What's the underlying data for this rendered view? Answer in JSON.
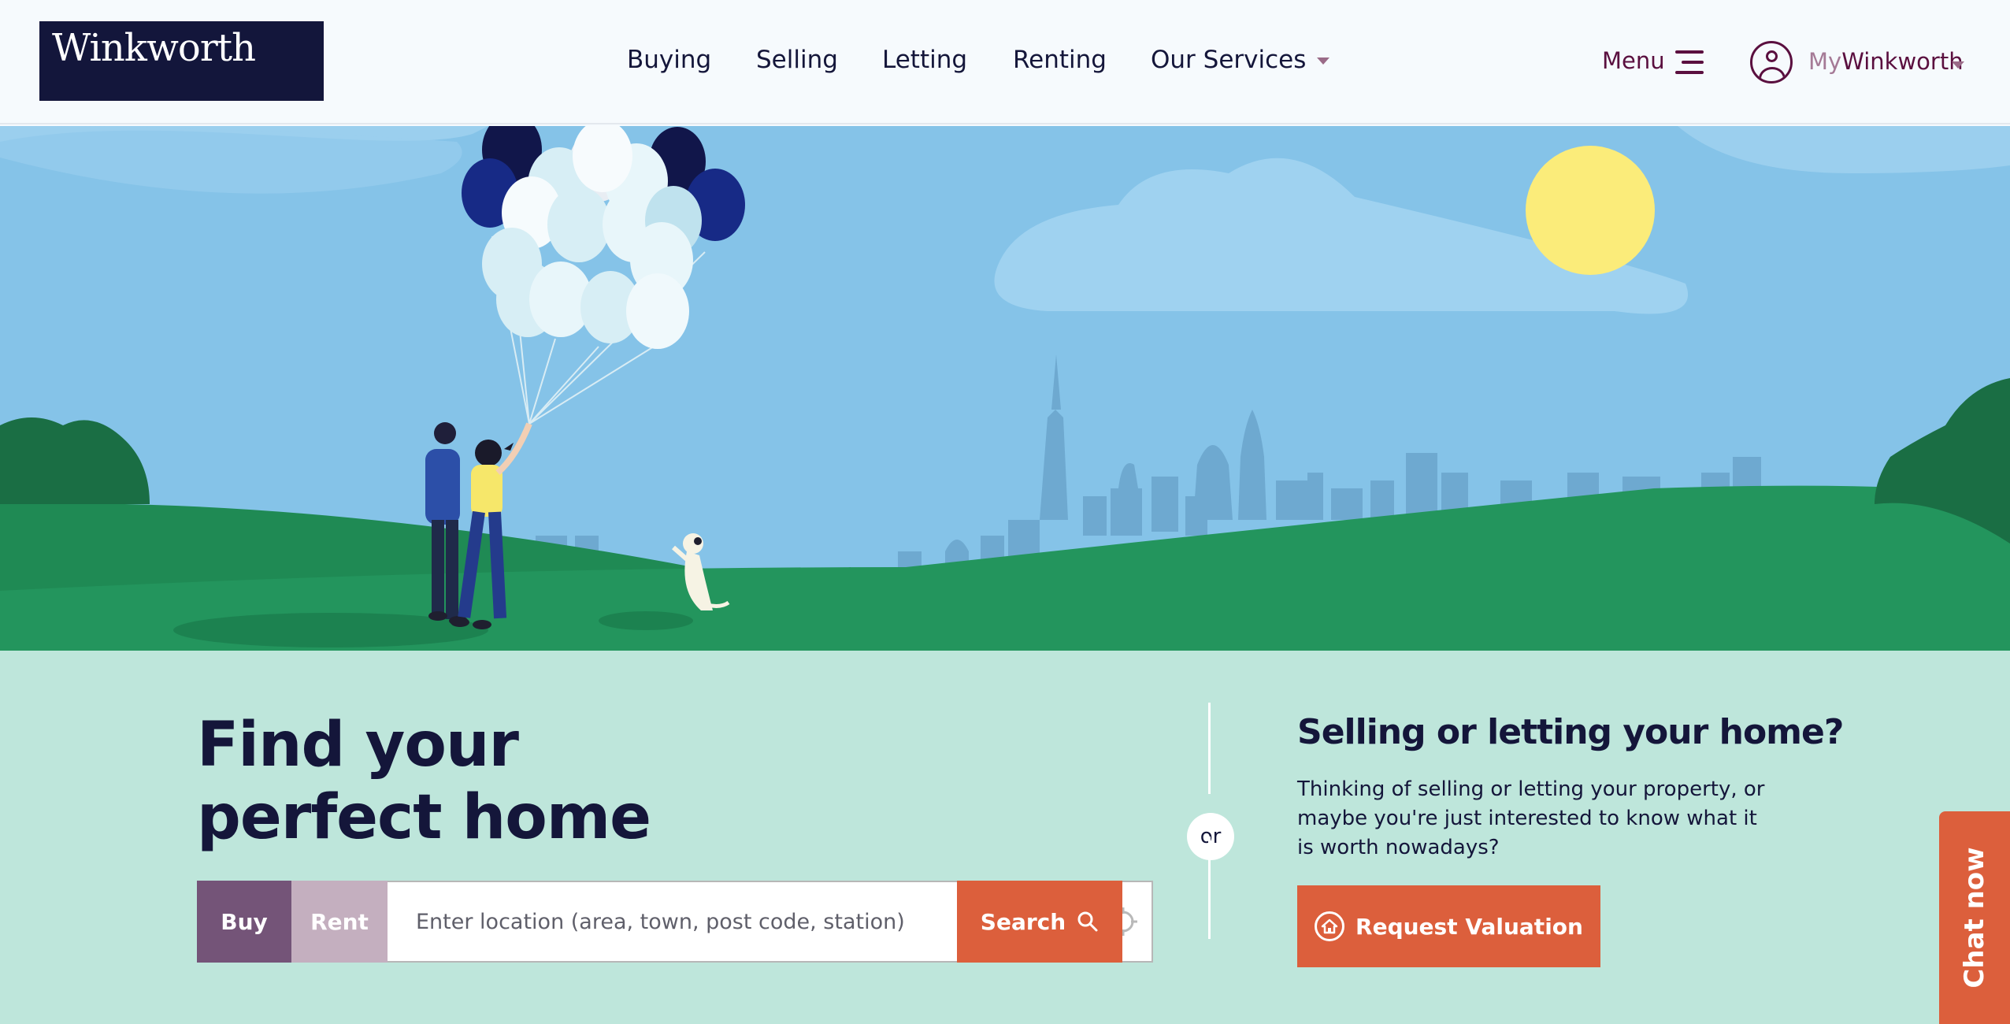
{
  "brand": {
    "logo_text": "Winkworth",
    "logo_bg": "#13163b"
  },
  "nav": {
    "items": [
      {
        "label": "Buying"
      },
      {
        "label": "Selling"
      },
      {
        "label": "Letting"
      },
      {
        "label": "Renting"
      },
      {
        "label": "Our Services",
        "has_dropdown": true
      }
    ],
    "menu_label": "Menu",
    "menu_icon": "hamburger-icon",
    "account": {
      "prefix": "My",
      "name": "Winkworth",
      "icon": "user-circle-icon"
    }
  },
  "hero": {
    "illustration": "couple-with-balloons-dog-city-skyline"
  },
  "search": {
    "title_line1": "Find your",
    "title_line2": "perfect home",
    "tabs": [
      {
        "label": "Buy",
        "active": true
      },
      {
        "label": "Rent",
        "active": false
      }
    ],
    "placeholder": "Enter location (area, town, post code, station)",
    "locate_icon": "crosshair-icon",
    "button_label": "Search",
    "button_icon": "search-icon"
  },
  "separator_label": "or",
  "valuation": {
    "title": "Selling or letting your home?",
    "text": "Thinking of selling or letting your property, or maybe you're just interested to know what it is worth nowadays?",
    "button_label": "Request Valuation",
    "button_icon": "home-icon"
  },
  "chat": {
    "label": "Chat now"
  },
  "colors": {
    "accent_orange": "#dc5f3c",
    "brand_plum": "#5a0f3f",
    "buy_tab": "#745478",
    "rent_tab": "#c4afbf",
    "mint_bg": "#bee6db",
    "navy_text": "#14163a"
  }
}
